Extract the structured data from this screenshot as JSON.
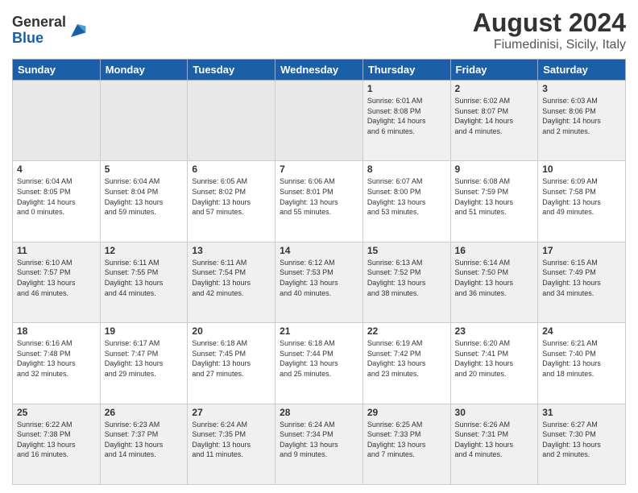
{
  "logo": {
    "general": "General",
    "blue": "Blue"
  },
  "title": "August 2024",
  "subtitle": "Fiumedinisi, Sicily, Italy",
  "days_of_week": [
    "Sunday",
    "Monday",
    "Tuesday",
    "Wednesday",
    "Thursday",
    "Friday",
    "Saturday"
  ],
  "weeks": [
    [
      {
        "day": "",
        "info": ""
      },
      {
        "day": "",
        "info": ""
      },
      {
        "day": "",
        "info": ""
      },
      {
        "day": "",
        "info": ""
      },
      {
        "day": "1",
        "info": "Sunrise: 6:01 AM\nSunset: 8:08 PM\nDaylight: 14 hours\nand 6 minutes."
      },
      {
        "day": "2",
        "info": "Sunrise: 6:02 AM\nSunset: 8:07 PM\nDaylight: 14 hours\nand 4 minutes."
      },
      {
        "day": "3",
        "info": "Sunrise: 6:03 AM\nSunset: 8:06 PM\nDaylight: 14 hours\nand 2 minutes."
      }
    ],
    [
      {
        "day": "4",
        "info": "Sunrise: 6:04 AM\nSunset: 8:05 PM\nDaylight: 14 hours\nand 0 minutes."
      },
      {
        "day": "5",
        "info": "Sunrise: 6:04 AM\nSunset: 8:04 PM\nDaylight: 13 hours\nand 59 minutes."
      },
      {
        "day": "6",
        "info": "Sunrise: 6:05 AM\nSunset: 8:02 PM\nDaylight: 13 hours\nand 57 minutes."
      },
      {
        "day": "7",
        "info": "Sunrise: 6:06 AM\nSunset: 8:01 PM\nDaylight: 13 hours\nand 55 minutes."
      },
      {
        "day": "8",
        "info": "Sunrise: 6:07 AM\nSunset: 8:00 PM\nDaylight: 13 hours\nand 53 minutes."
      },
      {
        "day": "9",
        "info": "Sunrise: 6:08 AM\nSunset: 7:59 PM\nDaylight: 13 hours\nand 51 minutes."
      },
      {
        "day": "10",
        "info": "Sunrise: 6:09 AM\nSunset: 7:58 PM\nDaylight: 13 hours\nand 49 minutes."
      }
    ],
    [
      {
        "day": "11",
        "info": "Sunrise: 6:10 AM\nSunset: 7:57 PM\nDaylight: 13 hours\nand 46 minutes."
      },
      {
        "day": "12",
        "info": "Sunrise: 6:11 AM\nSunset: 7:55 PM\nDaylight: 13 hours\nand 44 minutes."
      },
      {
        "day": "13",
        "info": "Sunrise: 6:11 AM\nSunset: 7:54 PM\nDaylight: 13 hours\nand 42 minutes."
      },
      {
        "day": "14",
        "info": "Sunrise: 6:12 AM\nSunset: 7:53 PM\nDaylight: 13 hours\nand 40 minutes."
      },
      {
        "day": "15",
        "info": "Sunrise: 6:13 AM\nSunset: 7:52 PM\nDaylight: 13 hours\nand 38 minutes."
      },
      {
        "day": "16",
        "info": "Sunrise: 6:14 AM\nSunset: 7:50 PM\nDaylight: 13 hours\nand 36 minutes."
      },
      {
        "day": "17",
        "info": "Sunrise: 6:15 AM\nSunset: 7:49 PM\nDaylight: 13 hours\nand 34 minutes."
      }
    ],
    [
      {
        "day": "18",
        "info": "Sunrise: 6:16 AM\nSunset: 7:48 PM\nDaylight: 13 hours\nand 32 minutes."
      },
      {
        "day": "19",
        "info": "Sunrise: 6:17 AM\nSunset: 7:47 PM\nDaylight: 13 hours\nand 29 minutes."
      },
      {
        "day": "20",
        "info": "Sunrise: 6:18 AM\nSunset: 7:45 PM\nDaylight: 13 hours\nand 27 minutes."
      },
      {
        "day": "21",
        "info": "Sunrise: 6:18 AM\nSunset: 7:44 PM\nDaylight: 13 hours\nand 25 minutes."
      },
      {
        "day": "22",
        "info": "Sunrise: 6:19 AM\nSunset: 7:42 PM\nDaylight: 13 hours\nand 23 minutes."
      },
      {
        "day": "23",
        "info": "Sunrise: 6:20 AM\nSunset: 7:41 PM\nDaylight: 13 hours\nand 20 minutes."
      },
      {
        "day": "24",
        "info": "Sunrise: 6:21 AM\nSunset: 7:40 PM\nDaylight: 13 hours\nand 18 minutes."
      }
    ],
    [
      {
        "day": "25",
        "info": "Sunrise: 6:22 AM\nSunset: 7:38 PM\nDaylight: 13 hours\nand 16 minutes."
      },
      {
        "day": "26",
        "info": "Sunrise: 6:23 AM\nSunset: 7:37 PM\nDaylight: 13 hours\nand 14 minutes."
      },
      {
        "day": "27",
        "info": "Sunrise: 6:24 AM\nSunset: 7:35 PM\nDaylight: 13 hours\nand 11 minutes."
      },
      {
        "day": "28",
        "info": "Sunrise: 6:24 AM\nSunset: 7:34 PM\nDaylight: 13 hours\nand 9 minutes."
      },
      {
        "day": "29",
        "info": "Sunrise: 6:25 AM\nSunset: 7:33 PM\nDaylight: 13 hours\nand 7 minutes."
      },
      {
        "day": "30",
        "info": "Sunrise: 6:26 AM\nSunset: 7:31 PM\nDaylight: 13 hours\nand 4 minutes."
      },
      {
        "day": "31",
        "info": "Sunrise: 6:27 AM\nSunset: 7:30 PM\nDaylight: 13 hours\nand 2 minutes."
      }
    ]
  ]
}
